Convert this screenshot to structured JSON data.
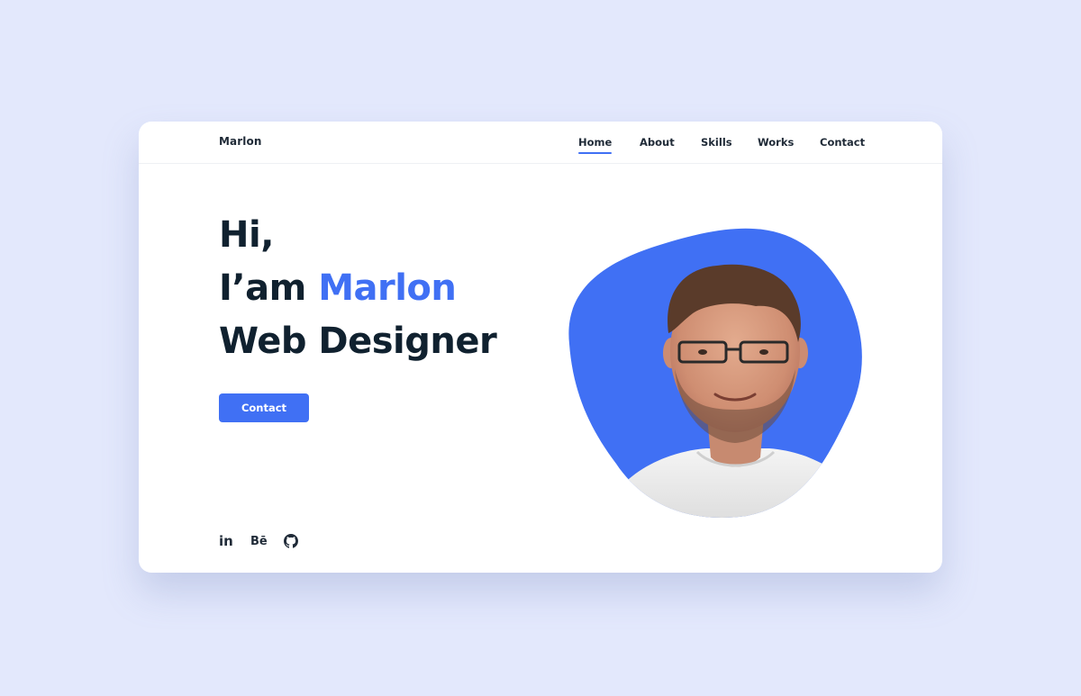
{
  "brand": {
    "name": "Marlon"
  },
  "nav": {
    "items": [
      {
        "label": "Home",
        "active": true
      },
      {
        "label": "About",
        "active": false
      },
      {
        "label": "Skills",
        "active": false
      },
      {
        "label": "Works",
        "active": false
      },
      {
        "label": "Contact",
        "active": false
      }
    ]
  },
  "hero": {
    "greeting": "Hi,",
    "intro_prefix": "I’am ",
    "name": "Marlon",
    "role": "Web Designer",
    "cta_label": "Contact"
  },
  "social": [
    {
      "icon": "linkedin-icon",
      "text": "in"
    },
    {
      "icon": "behance-icon",
      "text": "Bē"
    },
    {
      "icon": "github-icon"
    }
  ],
  "colors": {
    "accent": "#4070f4",
    "page_bg": "#e3e8fc",
    "card_bg": "#ffffff",
    "text_dark": "#10212f"
  }
}
